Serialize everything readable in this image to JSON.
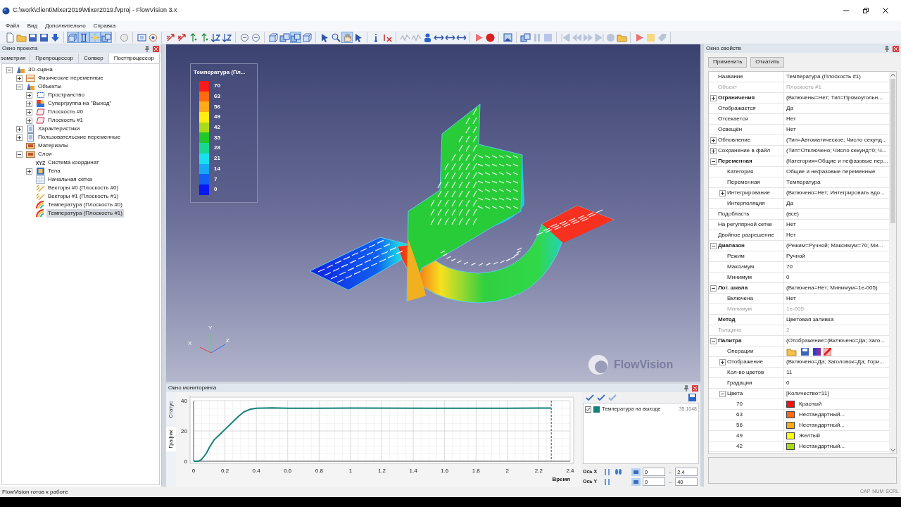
{
  "window": {
    "title": "C:\\work\\client\\Mixer2019\\Mixer2019.fvproj - FlowVision 3.x"
  },
  "menu": [
    "Файл",
    "Вид",
    "Дополнительно",
    "Справка"
  ],
  "toolbar": [
    [
      {
        "pressed": false
      },
      {
        "pressed": false
      },
      {
        "pressed": false
      },
      {
        "pressed": false
      },
      {
        "pressed": false
      }
    ],
    [
      {
        "pressed": true
      },
      {
        "pressed": true
      },
      {
        "pressed": true
      },
      {
        "pressed": true
      }
    ],
    [
      {
        "pressed": false
      }
    ],
    [
      {
        "pressed": false
      },
      {
        "pressed": false
      }
    ],
    [
      {
        "pressed": false
      },
      {
        "pressed": false
      },
      {
        "pressed": false
      },
      {
        "pressed": false
      },
      {
        "pressed": false
      },
      {
        "pressed": false
      }
    ],
    [
      {
        "pressed": false
      },
      {
        "pressed": false
      }
    ],
    [
      {
        "pressed": false
      },
      {
        "pressed": false
      },
      {
        "pressed": true
      },
      {
        "pressed": false
      }
    ],
    [
      {
        "pressed": false
      },
      {
        "pressed": false
      },
      {
        "pressed": true
      },
      {
        "pressed": false
      }
    ],
    [
      {
        "pressed": false
      },
      {
        "pressed": false
      }
    ],
    [
      {
        "pressed": false
      },
      {
        "pressed": false
      },
      {
        "pressed": false
      },
      {
        "pressed": false
      },
      {
        "pressed": false
      },
      {
        "pressed": false
      }
    ],
    [
      {
        "pressed": false
      },
      {
        "pressed": false
      }
    ],
    [
      {
        "pressed": false
      }
    ],
    [
      {
        "pressed": false
      },
      {
        "pressed": false
      },
      {
        "pressed": false
      }
    ],
    [
      {
        "pressed": false
      },
      {
        "pressed": false
      },
      {
        "pressed": false
      },
      {
        "pressed": false
      },
      {
        "pressed": false
      },
      {
        "pressed": false
      }
    ],
    [
      {
        "pressed": false
      },
      {
        "pressed": false
      },
      {
        "pressed": false
      }
    ]
  ],
  "project_panel": {
    "title": "Окно проекта",
    "tabs": [
      {
        "label": "эометрия",
        "selected": false
      },
      {
        "label": "Препроцессор",
        "selected": false
      },
      {
        "label": "Солвер",
        "selected": false
      },
      {
        "label": "Постпроцессор",
        "selected": true
      }
    ],
    "tree": [
      {
        "label": "3D-сцена",
        "kind": "scene",
        "expanded": true,
        "selected": false,
        "children": [
          {
            "label": "Физические переменные",
            "kind": "table",
            "expanded": false,
            "selected": false
          },
          {
            "label": "Объекты",
            "kind": "scene",
            "expanded": true,
            "selected": false,
            "children": [
              {
                "label": "Пространство",
                "kind": "frame",
                "expanded": false,
                "selected": false
              },
              {
                "label": "Супергруппа на \"Выход\"",
                "kind": "supergroup",
                "expanded": false,
                "selected": false
              },
              {
                "label": "Плоскость #0",
                "kind": "plane",
                "expanded": false,
                "selected": false
              },
              {
                "label": "Плоскость #1",
                "kind": "plane",
                "expanded": false,
                "selected": false
              }
            ]
          },
          {
            "label": "Характеристики",
            "kind": "document",
            "expanded": false,
            "selected": false
          },
          {
            "label": "Пользовательские переменные",
            "kind": "document",
            "expanded": false,
            "selected": false
          },
          {
            "label": "Материалы",
            "kind": "crate",
            "selected": false
          },
          {
            "label": "Слои",
            "kind": "crate",
            "expanded": true,
            "selected": false,
            "children": [
              {
                "label": "Система координат",
                "kind": "axes",
                "icon_text": "XYZ",
                "selected": false
              },
              {
                "label": "Тела",
                "kind": "cube",
                "expanded": false,
                "selected": false
              },
              {
                "label": "Начальная сетка",
                "kind": "grid",
                "selected": false
              },
              {
                "label": "Векторы #0 (Плоскость #0)",
                "kind": "vectors",
                "selected": false
              },
              {
                "label": "Векторы #1 (Плоскость #1)",
                "kind": "vectors",
                "selected": false
              },
              {
                "label": "Температура (Плоскость #0)",
                "kind": "contour",
                "selected": false
              },
              {
                "label": "Температура (Плоскость #1)",
                "kind": "contour",
                "selected": true
              }
            ]
          }
        ]
      }
    ]
  },
  "viewport": {
    "legend": {
      "title": "Температура (Пл...",
      "entries": [
        {
          "label": "70",
          "color": "#ff1a1a"
        },
        {
          "label": "63",
          "color": "#ff6a10"
        },
        {
          "label": "56",
          "color": "#ffaa18"
        },
        {
          "label": "49",
          "color": "#ffee10"
        },
        {
          "label": "42",
          "color": "#a8dc18"
        },
        {
          "label": "35",
          "color": "#20c828"
        },
        {
          "label": "28",
          "color": "#18d890"
        },
        {
          "label": "21",
          "color": "#18e0f0"
        },
        {
          "label": "14",
          "color": "#18a8f8"
        },
        {
          "label": "7",
          "color": "#1060f8"
        },
        {
          "label": "0",
          "color": "#0818f0"
        }
      ]
    },
    "axes": {
      "x": "X",
      "y": "Y",
      "z": "Z"
    },
    "logo_text": "FlowVision"
  },
  "monitor": {
    "title": "Окно мониторинга",
    "tabs": [
      {
        "label": "Статус",
        "selected": false
      },
      {
        "label": "График",
        "selected": true
      }
    ],
    "chart_data": {
      "type": "line",
      "xlabel": "Время",
      "xlim": [
        0,
        2.4
      ],
      "ylim": [
        0,
        40
      ],
      "xticks": [
        0,
        0.2,
        0.4,
        0.6,
        0.8,
        1,
        1.2,
        1.4,
        1.6,
        1.8,
        2,
        2.2,
        2.4
      ],
      "yticks": [
        0,
        20,
        40
      ],
      "x": [
        0,
        0.03,
        0.05,
        0.08,
        0.1,
        0.13,
        0.16,
        0.2,
        0.24,
        0.28,
        0.32,
        0.36,
        0.4,
        0.5,
        0.6,
        0.8,
        1,
        1.5,
        2,
        2.28
      ],
      "series": [
        {
          "name": "Температура на выходе",
          "color": "#13807a",
          "values": [
            0,
            0,
            1,
            5,
            9,
            14,
            17,
            21,
            25,
            29,
            32.5,
            34.3,
            35,
            35.2,
            35,
            35,
            35.1,
            35,
            35,
            35.1
          ]
        }
      ],
      "grid": true,
      "ref_lines": [
        {
          "axis": "x",
          "value": 2.28
        }
      ]
    },
    "series_list": [
      {
        "checked": true,
        "value": "35.1048"
      }
    ],
    "axis_x": {
      "label": "Ось X",
      "min": "0",
      "separator": "..",
      "max": "2.4"
    },
    "axis_y": {
      "label": "Ось Y",
      "min": "0",
      "separator": "..",
      "max": "40"
    }
  },
  "properties_panel": {
    "title": "Окно свойств",
    "buttons": [
      "Применить",
      "Откатить"
    ],
    "rows": [
      {
        "label": "Название",
        "value": "Температура (Плоскость #1)",
        "bold": false,
        "disabled": false
      },
      {
        "label": "Объект",
        "value": "Плоскость #1",
        "bold": false,
        "disabled": true
      },
      {
        "label": "Ограничения",
        "value": "(Включены=Нет; Тип=Прямоугольн...",
        "bold": true,
        "disabled": false,
        "expanded": false
      },
      {
        "label": "Отображается",
        "value": "Да",
        "bold": false,
        "disabled": false
      },
      {
        "label": "Отсекается",
        "value": "Нет",
        "bold": false,
        "disabled": false
      },
      {
        "label": "Освещён",
        "value": "Нет",
        "bold": false,
        "disabled": false
      },
      {
        "label": "Обновление",
        "value": "(Тип=Автоматическое; Число секунд...",
        "bold": false,
        "disabled": false,
        "expanded": false
      },
      {
        "label": "Сохранение в файл",
        "value": "(Тип=Отключено; Число секунд=0; Ч...",
        "bold": false,
        "disabled": false,
        "expanded": false
      },
      {
        "label": "Переменная",
        "value": "(Категория=Общие и нефазовые пер...",
        "bold": true,
        "disabled": false,
        "expanded": true,
        "children": [
          {
            "label": "Категория",
            "value": "Общие и нефазовые переменные",
            "bold": false,
            "disabled": false
          },
          {
            "label": "Переменная",
            "value": "Температура",
            "bold": false,
            "disabled": false
          },
          {
            "label": "Интегрирование",
            "value": "(Включено=Нет; Интегрировать вдо...",
            "bold": false,
            "disabled": false,
            "expanded": false
          },
          {
            "label": "Интерполяция",
            "value": "Да",
            "bold": false,
            "disabled": false
          }
        ]
      },
      {
        "label": "Подобласть",
        "value": "(все)",
        "bold": false,
        "disabled": false
      },
      {
        "label": "На регулярной сетке",
        "value": "Нет",
        "bold": false,
        "disabled": false
      },
      {
        "label": "Двойное разрешение",
        "value": "Нет",
        "bold": false,
        "disabled": false
      },
      {
        "label": "Диапазон",
        "value": "(Режим=Ручной; Максимум=70; Ми...",
        "bold": true,
        "disabled": false,
        "expanded": true,
        "children": [
          {
            "label": "Режим",
            "value": "Ручной",
            "bold": false,
            "disabled": false
          },
          {
            "label": "Максимум",
            "value": "70",
            "bold": false,
            "disabled": false
          },
          {
            "label": "Минимум",
            "value": "0",
            "bold": false,
            "disabled": false
          }
        ]
      },
      {
        "label": "Лог. шкала",
        "value": "(Включена=Нет; Минимум=1e-005)",
        "bold": true,
        "disabled": false,
        "expanded": true,
        "children": [
          {
            "label": "Включена",
            "value": "Нет",
            "bold": false,
            "disabled": false
          },
          {
            "label": "Минимум",
            "value": "1e-005",
            "bold": false,
            "disabled": true
          }
        ]
      },
      {
        "label": "Метод",
        "value": "Цветовая заливка",
        "bold": true,
        "disabled": false
      },
      {
        "label": "Толщина",
        "value": "2",
        "bold": false,
        "disabled": true
      },
      {
        "label": "Палитра",
        "value": "(Отображение=(Включено=Да; Заго...",
        "bold": true,
        "disabled": false,
        "expanded": true,
        "children": [
          {
            "label": "Операции",
            "kind": "icons",
            "bold": false,
            "disabled": false
          },
          {
            "label": "Отображение",
            "value": "(Включено=Да; Заголовок=Да; Гори...",
            "bold": false,
            "disabled": false,
            "expanded": false
          },
          {
            "label": "Кол-во цветов",
            "value": "11",
            "bold": false,
            "disabled": false
          },
          {
            "label": "Градации",
            "value": "0",
            "bold": false,
            "disabled": false
          },
          {
            "label": "Цвета",
            "value": "[Количество=11]",
            "bold": false,
            "disabled": false,
            "expanded": true,
            "children": [
              {
                "label": "70",
                "kind": "color",
                "color": "#ff1010",
                "value": "Красный",
                "bold": false,
                "disabled": false
              },
              {
                "label": "63",
                "kind": "color",
                "color": "#ff6a10",
                "value": "Нестандартный...",
                "bold": false,
                "disabled": false
              },
              {
                "label": "56",
                "kind": "color",
                "color": "#ffaa18",
                "value": "Нестандартный...",
                "bold": false,
                "disabled": false
              },
              {
                "label": "49",
                "kind": "color",
                "color": "#ffff10",
                "value": "Желтый",
                "bold": false,
                "disabled": false
              },
              {
                "label": "42",
                "kind": "color",
                "color": "#a8dc18",
                "value": "Нестандартный...",
                "bold": false,
                "disabled": false
              }
            ]
          }
        ]
      }
    ]
  },
  "status_bar": {
    "message": "FlowVision готов к работе",
    "indicators": [
      "CAP",
      "NUM",
      "SCRL"
    ]
  }
}
